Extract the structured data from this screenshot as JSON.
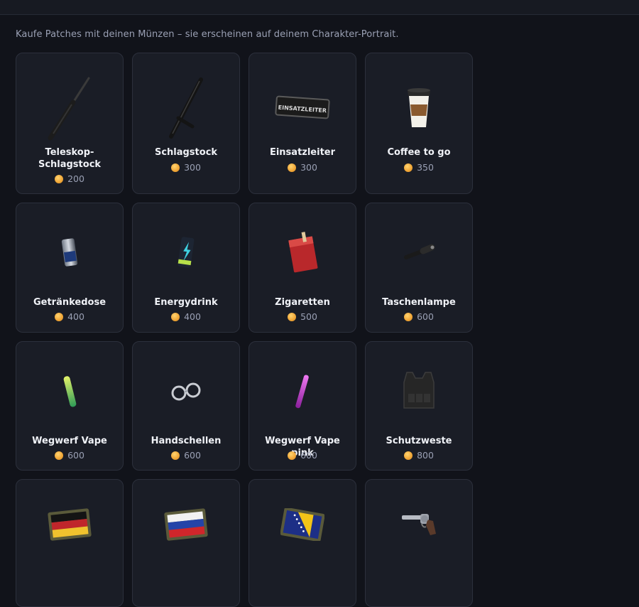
{
  "intro_text": "Kaufe Patches mit deinen Münzen – sie erscheinen auf deinem Charakter-Portrait.",
  "coin_color": "#f2a93a",
  "items": [
    {
      "name": "Teleskop-Schlagstock",
      "price": "200",
      "icon": "telescopic-baton-icon"
    },
    {
      "name": "Schlagstock",
      "price": "300",
      "icon": "baton-icon"
    },
    {
      "name": "Einsatzleiter",
      "price": "300",
      "icon": "einsatzleiter-patch-icon",
      "patch_text": "EINSATZLEITER"
    },
    {
      "name": "Coffee to go",
      "price": "350",
      "icon": "coffee-cup-icon"
    },
    {
      "name": "Getränkedose",
      "price": "400",
      "icon": "drink-can-icon"
    },
    {
      "name": "Energydrink",
      "price": "400",
      "icon": "energy-drink-icon"
    },
    {
      "name": "Zigaretten",
      "price": "500",
      "icon": "cigarettes-icon"
    },
    {
      "name": "Taschenlampe",
      "price": "600",
      "icon": "flashlight-icon"
    },
    {
      "name": "Wegwerf Vape",
      "price": "600",
      "icon": "vape-green-icon"
    },
    {
      "name": "Handschellen",
      "price": "600",
      "icon": "handcuffs-icon"
    },
    {
      "name": "Wegwerf Vape pink",
      "price": "600",
      "icon": "vape-pink-icon"
    },
    {
      "name": "Schutzweste",
      "price": "800",
      "icon": "vest-icon"
    },
    {
      "name": "",
      "price": "",
      "icon": "germany-flag-patch-icon"
    },
    {
      "name": "",
      "price": "",
      "icon": "russia-flag-patch-icon"
    },
    {
      "name": "",
      "price": "",
      "icon": "bosnia-flag-patch-icon"
    },
    {
      "name": "",
      "price": "",
      "icon": "revolver-icon"
    }
  ]
}
